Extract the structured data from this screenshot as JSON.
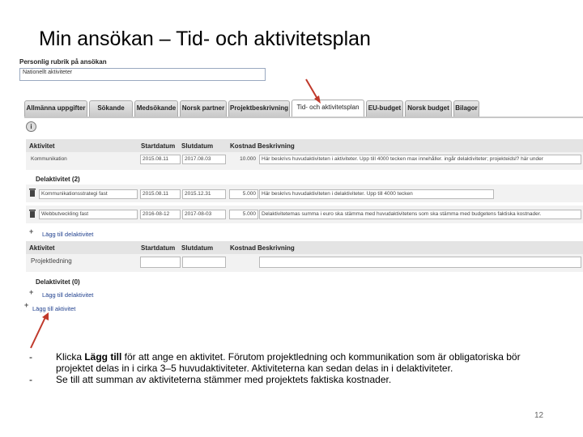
{
  "slide": {
    "title": "Min ansökan – Tid- och aktivitetsplan",
    "page_number": "12"
  },
  "form": {
    "personal_label": "Personlig rubrik på ansökan",
    "personal_value": "Nationellt aktiviteter"
  },
  "tabs": [
    {
      "label": "Allmänna uppgifter",
      "active": false
    },
    {
      "label": "Sökande",
      "active": false
    },
    {
      "label": "Medsökande",
      "active": false
    },
    {
      "label": "Norsk partner",
      "active": false
    },
    {
      "label": "Projektbeskrivning",
      "active": false
    },
    {
      "label": "Tid- och aktivitetsplan",
      "active": true
    },
    {
      "label": "EU-budget",
      "active": false
    },
    {
      "label": "Norsk budget",
      "active": false
    },
    {
      "label": "Bilagor",
      "active": false
    }
  ],
  "columns": {
    "aktivitet": "Aktivitet",
    "startdatum": "Startdatum",
    "slutdatum": "Slutdatum",
    "kostnad": "Kostnad",
    "beskrivning": "Beskrivning"
  },
  "activity1": {
    "name": "Kommunikation",
    "start": "2015.08.11",
    "end": "2017.08.03",
    "cost": "10.000",
    "description": "Här beskrivs huvudaktiviteten i aktiviteter. Upp till 4000 tecken max innehåller. ingår delaktiviteter; projekteidsl? här under",
    "sub_header": "Delaktivitet (2)",
    "subactivities": [
      {
        "name": "Kommunikationsstrategi fast",
        "start": "2015.08.11",
        "end": "2015.12.31",
        "cost": "5.000",
        "description": "Här beskrivs huvudaktiviteten i delaktiviteter. Upp till 4000 tecken"
      },
      {
        "name": "Webbutveckling fast",
        "start": "2016-08-12",
        "end": "2017-08-03",
        "cost": "5.000",
        "description": "Delaktivitetemas summa i euro ska stämma med huvudaktivitetens som ska stämma med budgetens faktiska kostnader."
      }
    ],
    "add_sub_link": "Lägg till delaktivitet"
  },
  "activity2": {
    "name": "Projektledning",
    "sub_header": "Delaktivitet (0)",
    "add_sub_link": "Lägg till delaktivitet"
  },
  "add_activity_link": "Lägg till aktivitet",
  "bullets": [
    {
      "pre": "Klicka ",
      "bold": "Lägg till",
      "post": " för att ange en aktivitet. Förutom projektledning och kommunikation som är obligatoriska bör projektet delas in i cirka 3–5 huvudaktiviteter. Aktiviteterna kan sedan delas in i delaktiviteter."
    },
    {
      "pre": "Se till att summan av aktiviteterna stämmer med projektets faktiska kostnader.",
      "bold": "",
      "post": ""
    }
  ],
  "colors": {
    "arrow": "#c0392b",
    "link": "#22428f",
    "header_bg": "#e4e4e4"
  }
}
